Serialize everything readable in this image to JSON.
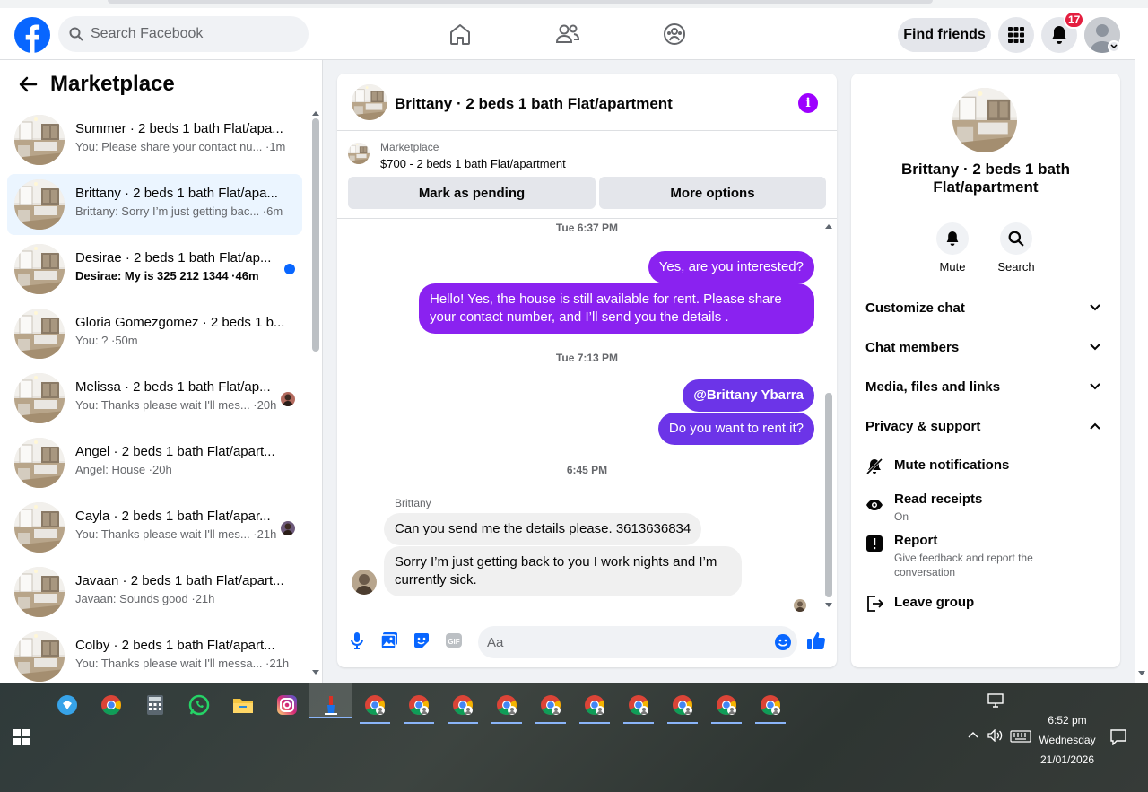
{
  "header": {
    "search_placeholder": "Search Facebook",
    "find_friends": "Find friends",
    "notif_count": "17"
  },
  "left": {
    "title": "Marketplace",
    "conversations": [
      {
        "name": "Summer · 2 beds 1 bath Flat/apa...",
        "snippet": "You: Please share your contact nu...  ·1m"
      },
      {
        "name": "Brittany · 2 beds 1 bath Flat/apa...",
        "snippet": "Brittany: Sorry I’m just getting bac... ·6m"
      },
      {
        "name": "Desirae · 2 beds 1 bath Flat/ap...",
        "snippet": "Desirae: My is 325 212 1344 ·46m"
      },
      {
        "name": "Gloria Gomezgomez · 2 beds 1 b...",
        "snippet": "You: ? ·50m"
      },
      {
        "name": "Melissa · 2 beds 1 bath Flat/ap...",
        "snippet": "You: Thanks please wait I'll mes... ·20h"
      },
      {
        "name": "Angel · 2 beds 1 bath Flat/apart...",
        "snippet": "Angel: House ·20h"
      },
      {
        "name": "Cayla · 2 beds 1 bath Flat/apar...",
        "snippet": "You: Thanks please wait I'll mes... ·21h"
      },
      {
        "name": "Javaan · 2 beds 1 bath Flat/apart...",
        "snippet": "Javaan: Sounds good ·21h"
      },
      {
        "name": "Colby · 2 beds 1 bath Flat/apart...",
        "snippet": "You: Thanks please wait I'll messa... ·21h"
      }
    ]
  },
  "chat": {
    "title": "Brittany · 2 beds 1 bath Flat/apartment",
    "listing_source": "Marketplace",
    "listing_title": "$700 - 2 beds 1 bath Flat/apartment",
    "btn_pending": "Mark as pending",
    "btn_more": "More options",
    "ts1": "Tue 6:37 PM",
    "msg1": "Yes, are you interested?",
    "msg2": "Hello! Yes, the house is still available for rent. Please share your contact number, and I’ll send you the details .",
    "ts2": "Tue 7:13 PM",
    "msg3": "@Brittany Ybarra",
    "msg4": "Do you want to rent it?",
    "ts3": "6:45 PM",
    "sender": "Brittany",
    "msg5": "Can you send me the details please. 3613636834",
    "msg6": "Sorry I’m just getting back to you I work nights and I’m currently sick.",
    "composer_placeholder": "Aa"
  },
  "right": {
    "name": "Brittany · 2 beds 1 bath Flat/apartment",
    "mute": "Mute",
    "search": "Search",
    "sections": [
      "Customize chat",
      "Chat members",
      "Media, files and links",
      "Privacy & support"
    ],
    "mute_notifications": "Mute notifications",
    "read_receipts": "Read receipts",
    "read_receipts_state": "On",
    "report": "Report",
    "report_sub": "Give feedback and report the conversation",
    "leave_group": "Leave group"
  },
  "taskbar": {
    "time": "6:52 pm",
    "day": "Wednesday",
    "date": "21/01/2026"
  },
  "colors": {
    "fb_blue": "#0866ff",
    "bubble_out": "#8a22f0",
    "bubble_out_alt": "#6c34e8",
    "accent_purple": "#9d00ff"
  }
}
